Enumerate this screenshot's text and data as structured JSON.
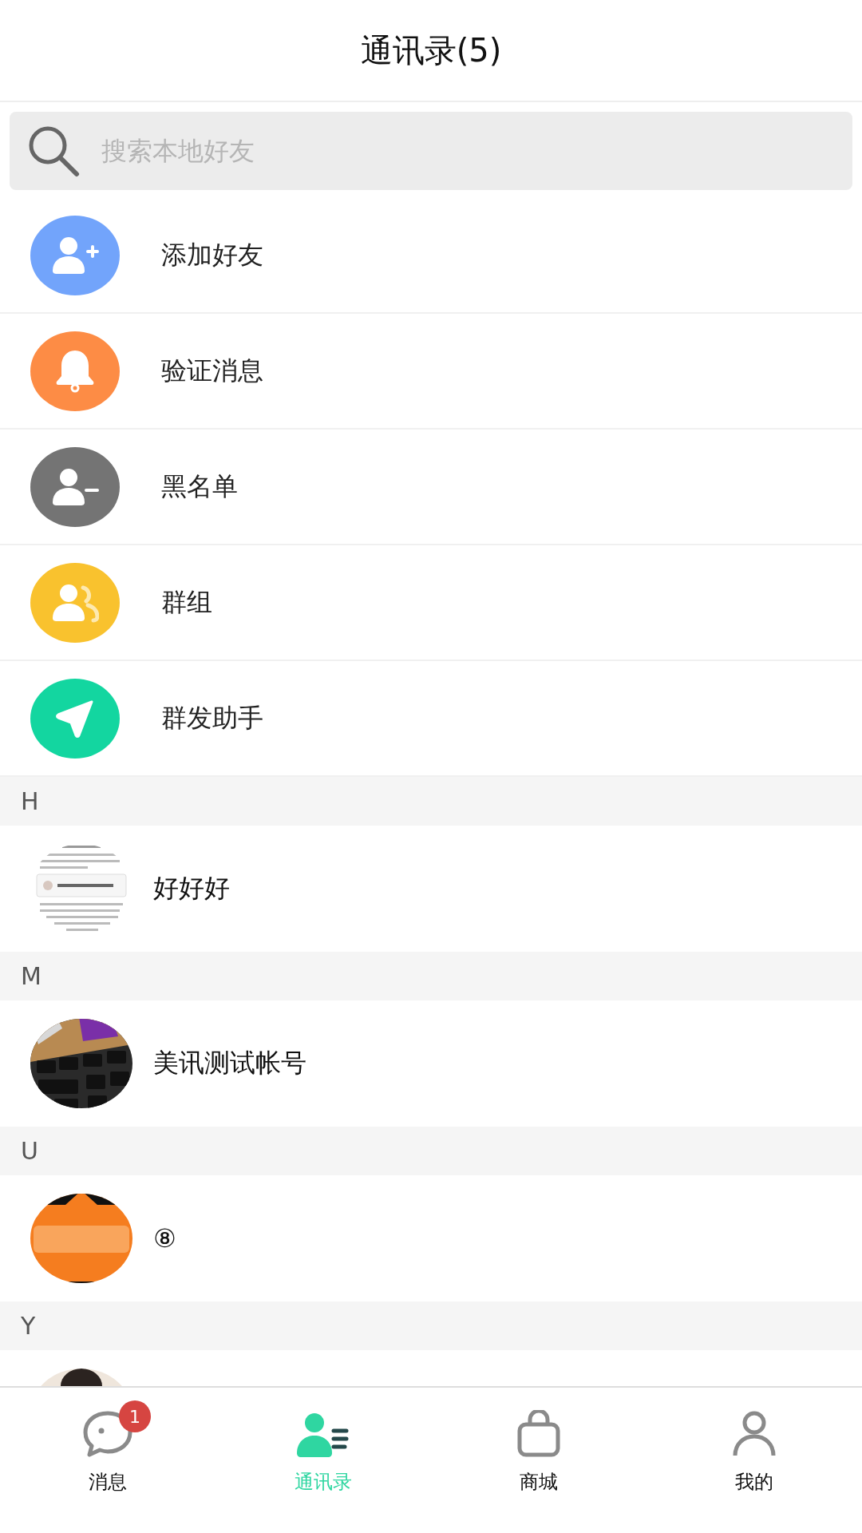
{
  "header": {
    "title": "通讯录(5)"
  },
  "search": {
    "placeholder": "搜索本地好友"
  },
  "menu": [
    {
      "label": "添加好友",
      "kind": "add",
      "color": "#72a4fb"
    },
    {
      "label": "验证消息",
      "kind": "verify",
      "color": "#fd8c45"
    },
    {
      "label": "黑名单",
      "kind": "blacklist",
      "color": "#747474"
    },
    {
      "label": "群组",
      "kind": "groups",
      "color": "#f9c22e"
    },
    {
      "label": "群发助手",
      "kind": "broadcast",
      "color": "#13d6a0"
    }
  ],
  "sections": [
    {
      "letter": "H",
      "contacts": [
        {
          "name": "好好好",
          "kind": "picture"
        }
      ]
    },
    {
      "letter": "M",
      "contacts": [
        {
          "name": "美讯测试帐号",
          "kind": "picture"
        }
      ]
    },
    {
      "letter": "U",
      "contacts": [
        {
          "name": "⑧",
          "kind": "picture"
        }
      ]
    },
    {
      "letter": "Y"
    }
  ],
  "tabs": [
    {
      "label": "消息",
      "kind": "messages",
      "selected": false,
      "badge": "1"
    },
    {
      "label": "通讯录",
      "kind": "contacts",
      "selected": true
    },
    {
      "label": "商城",
      "kind": "shop",
      "selected": false
    },
    {
      "label": "我的",
      "kind": "profile",
      "selected": false
    }
  ]
}
